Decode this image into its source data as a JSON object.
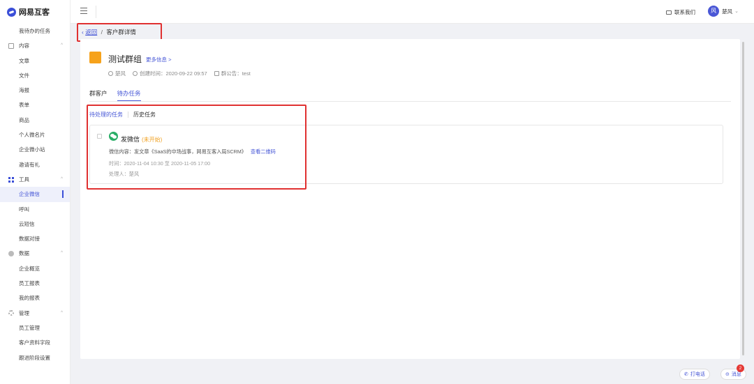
{
  "app": {
    "logo_text": "网易互客"
  },
  "sidebar": {
    "items": [
      {
        "type": "item",
        "label": "我待办的任务"
      },
      {
        "type": "group",
        "label": "内容",
        "icon": "doc"
      },
      {
        "type": "item",
        "label": "文章"
      },
      {
        "type": "item",
        "label": "文件"
      },
      {
        "type": "item",
        "label": "海报"
      },
      {
        "type": "item",
        "label": "表单"
      },
      {
        "type": "item",
        "label": "商品"
      },
      {
        "type": "item",
        "label": "个人微名片"
      },
      {
        "type": "item",
        "label": "企业微小站"
      },
      {
        "type": "item",
        "label": "邀请有礼"
      },
      {
        "type": "group",
        "label": "工具",
        "icon": "tool"
      },
      {
        "type": "item",
        "label": "企业微信",
        "active": true
      },
      {
        "type": "item",
        "label": "呼叫"
      },
      {
        "type": "item",
        "label": "云短信"
      },
      {
        "type": "item",
        "label": "数据对接"
      },
      {
        "type": "group",
        "label": "数据",
        "icon": "data"
      },
      {
        "type": "item",
        "label": "企业概览"
      },
      {
        "type": "item",
        "label": "员工报表"
      },
      {
        "type": "item",
        "label": "我的报表"
      },
      {
        "type": "group",
        "label": "管理",
        "icon": "manage"
      },
      {
        "type": "item",
        "label": "员工管理"
      },
      {
        "type": "item",
        "label": "客户资料字段"
      },
      {
        "type": "item",
        "label": "跟进阶段设置"
      }
    ]
  },
  "topbar": {
    "contact_label": "联系我们",
    "avatar_char": "风",
    "user_name": "楚风"
  },
  "breadcrumb": {
    "back_label": "返回",
    "separator": "/",
    "current": "客户群详情"
  },
  "group": {
    "name": "测试群组",
    "more_info": "更多信息 >",
    "owner": "楚风",
    "created": "创建时间：2020-09-22 09:57",
    "notice": "群公告：test",
    "logo_color": "#f6a21b"
  },
  "tabs": [
    {
      "label": "群客户",
      "active": false
    },
    {
      "label": "待办任务",
      "active": true
    }
  ],
  "subtabs": [
    {
      "label": "待处理的任务",
      "active": true
    },
    {
      "label": "历史任务",
      "active": false
    }
  ],
  "task": {
    "title": "发微信",
    "status": "(未开始)",
    "content": "微信内容：发文章《SaaS的中场战事，网易互客入局SCRM》",
    "qr_link": "查看二维码",
    "time": "时间：2020-11-04 10:30 至 2020-11-05 17:00",
    "handler": "处理人：楚风"
  },
  "float_buttons": {
    "call_label": "打电话",
    "message_label": "消息",
    "message_badge": "2"
  },
  "colors": {
    "accent": "#4455d6",
    "highlight": "#e03030",
    "wechat": "#2aae67"
  }
}
